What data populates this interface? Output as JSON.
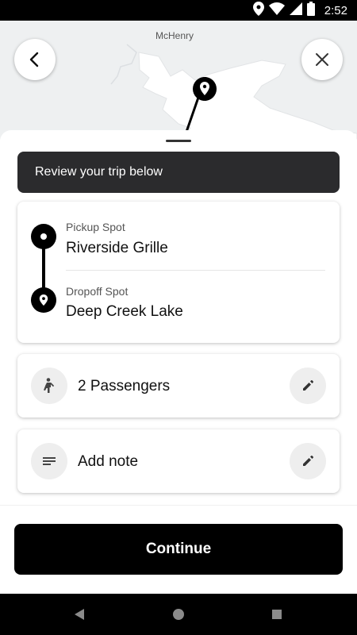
{
  "status_bar": {
    "time": "2:52"
  },
  "map": {
    "town_label": "McHenry"
  },
  "review_banner": "Review your trip below",
  "trip": {
    "pickup_label": "Pickup Spot",
    "pickup_value": "Riverside Grille",
    "dropoff_label": "Dropoff Spot",
    "dropoff_value": "Deep Creek Lake"
  },
  "passengers": {
    "text": "2 Passengers",
    "icon": "person-icon"
  },
  "note": {
    "text": "Add note",
    "icon": "notes-icon"
  },
  "continue_label": "Continue",
  "colors": {
    "primary": "#000000",
    "banner": "#2b2b2d",
    "icon_bg": "#eeeeee"
  }
}
